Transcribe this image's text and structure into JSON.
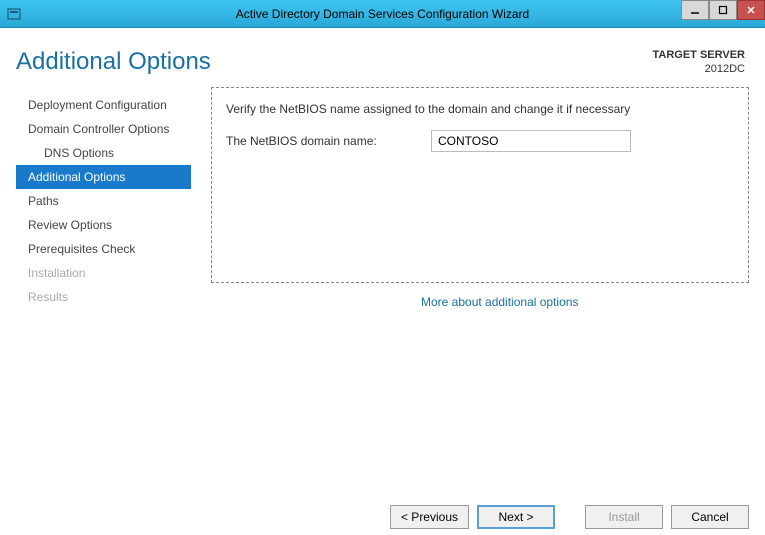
{
  "titlebar": {
    "title": "Active Directory Domain Services Configuration Wizard"
  },
  "header": {
    "page_title": "Additional Options",
    "target_label": "TARGET SERVER",
    "target_value": "2012DC"
  },
  "sidebar": {
    "items": [
      {
        "label": "Deployment Configuration",
        "selected": false,
        "disabled": false,
        "indent": false
      },
      {
        "label": "Domain Controller Options",
        "selected": false,
        "disabled": false,
        "indent": false
      },
      {
        "label": "DNS Options",
        "selected": false,
        "disabled": false,
        "indent": true
      },
      {
        "label": "Additional Options",
        "selected": true,
        "disabled": false,
        "indent": false
      },
      {
        "label": "Paths",
        "selected": false,
        "disabled": false,
        "indent": false
      },
      {
        "label": "Review Options",
        "selected": false,
        "disabled": false,
        "indent": false
      },
      {
        "label": "Prerequisites Check",
        "selected": false,
        "disabled": false,
        "indent": false
      },
      {
        "label": "Installation",
        "selected": false,
        "disabled": true,
        "indent": false
      },
      {
        "label": "Results",
        "selected": false,
        "disabled": true,
        "indent": false
      }
    ]
  },
  "content": {
    "instruction": "Verify the NetBIOS name assigned to the domain and change it if necessary",
    "netbios_label": "The NetBIOS domain name:",
    "netbios_value": "CONTOSO",
    "more_link": "More about additional options"
  },
  "footer": {
    "previous": "< Previous",
    "next": "Next >",
    "install": "Install",
    "cancel": "Cancel"
  }
}
